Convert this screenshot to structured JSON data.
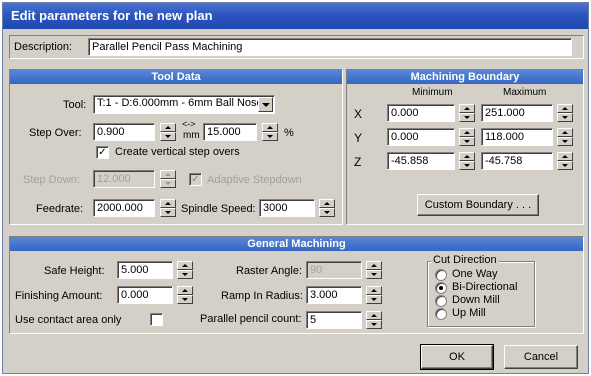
{
  "window": {
    "title": "Edit parameters for the new plan"
  },
  "description": {
    "label": "Description:",
    "value": "Parallel Pencil Pass Machining"
  },
  "tool_data": {
    "header": "Tool Data",
    "tool_label": "Tool:",
    "tool_value": "T:1 - D:6.000mm - 6mm Ball Nose",
    "step_over_label": "Step Over:",
    "step_over_value": "0.900",
    "mm_symbol": "<->",
    "mm_label": "mm",
    "step_over_pct_value": "15.000",
    "pct_label": "%",
    "vertical_step_label": "Create vertical step overs",
    "vertical_step_checked": true,
    "step_down_label": "Step Down:",
    "step_down_value": "12.000",
    "adaptive_label": "Adaptive Stepdown",
    "adaptive_checked": true,
    "feedrate_label": "Feedrate:",
    "feedrate_value": "2000.000",
    "spindle_label": "Spindle Speed:",
    "spindle_value": "3000"
  },
  "boundary": {
    "header": "Machining Boundary",
    "min_label": "Minimum",
    "max_label": "Maximum",
    "rows": [
      {
        "axis": "X",
        "min": "0.000",
        "max": "251.000"
      },
      {
        "axis": "Y",
        "min": "0.000",
        "max": "118.000"
      },
      {
        "axis": "Z",
        "min": "-45.858",
        "max": "-45.758"
      }
    ],
    "custom_button": "Custom Boundary . . ."
  },
  "general": {
    "header": "General Machining",
    "safe_height_label": "Safe Height:",
    "safe_height_value": "5.000",
    "finishing_label": "Finishing Amount:",
    "finishing_value": "0.000",
    "contact_label": "Use contact area only",
    "contact_checked": false,
    "raster_label": "Raster Angle:",
    "raster_value": "90",
    "ramp_label": "Ramp In Radius:",
    "ramp_value": "3.000",
    "pencil_label": "Parallel pencil count:",
    "pencil_value": "5"
  },
  "cut_direction": {
    "title": "Cut Direction",
    "options": [
      "One Way",
      "Bi-Directional",
      "Down Mill",
      "Up Mill"
    ],
    "selected": "Bi-Directional"
  },
  "buttons": {
    "ok": "OK",
    "cancel": "Cancel"
  }
}
